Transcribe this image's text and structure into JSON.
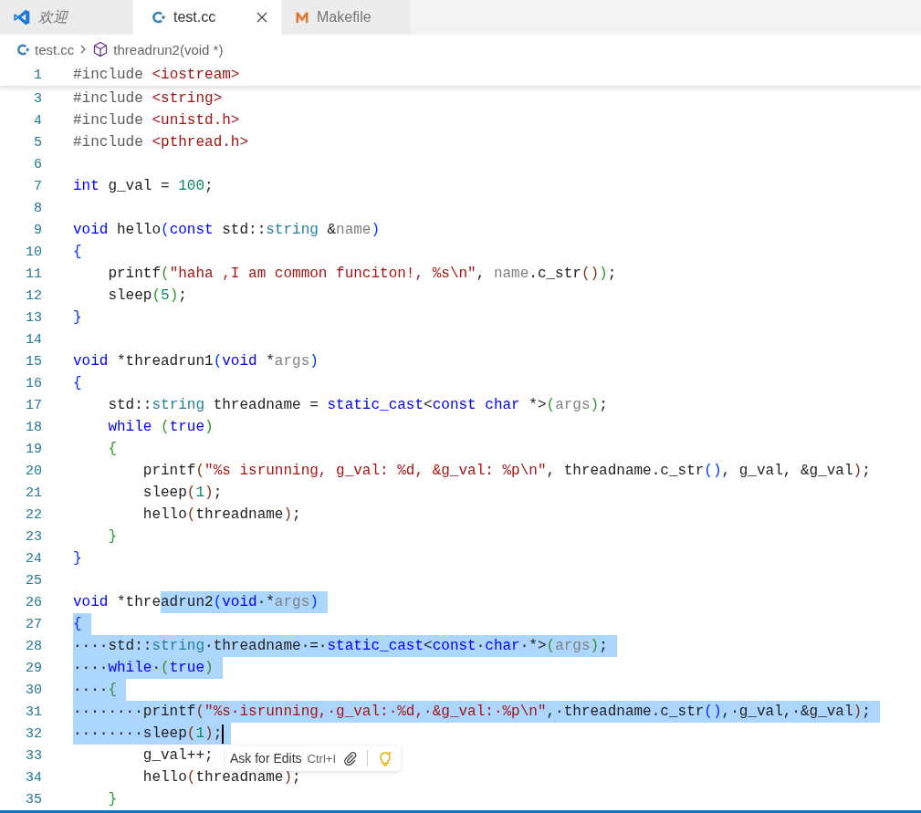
{
  "tabs": [
    {
      "label": "欢迎",
      "kind": "welcome",
      "selected": false
    },
    {
      "label": "test.cc",
      "kind": "cpp",
      "selected": true
    },
    {
      "label": "Makefile",
      "kind": "makefile",
      "selected": false
    }
  ],
  "breadcrumb": [
    {
      "label": "test.cc",
      "kind": "file"
    },
    {
      "label": "threadrun2(void *)",
      "kind": "symbol"
    }
  ],
  "sticky_line": {
    "number": "1",
    "tokens": [
      {
        "text": "#include ",
        "kind": "pp"
      },
      {
        "text": "<iostream>",
        "kind": "str"
      }
    ]
  },
  "lines": [
    {
      "number": "3",
      "tokens": [
        {
          "text": "#include ",
          "kind": "pp"
        },
        {
          "text": "<string>",
          "kind": "str"
        }
      ]
    },
    {
      "number": "4",
      "tokens": [
        {
          "text": "#include ",
          "kind": "pp"
        },
        {
          "text": "<unistd.h>",
          "kind": "str"
        }
      ]
    },
    {
      "number": "5",
      "tokens": [
        {
          "text": "#include ",
          "kind": "pp"
        },
        {
          "text": "<pthread.h>",
          "kind": "str"
        }
      ]
    },
    {
      "number": "6"
    },
    {
      "number": "7",
      "tokens": [
        {
          "text": "int",
          "kind": "kw"
        },
        {
          "text": " g_val = ",
          "kind": "plain"
        },
        {
          "text": "100",
          "kind": "num"
        },
        {
          "text": ";",
          "kind": "plain"
        }
      ]
    },
    {
      "number": "8"
    },
    {
      "number": "9",
      "tokens": [
        {
          "text": "void",
          "kind": "kw"
        },
        {
          "text": " hello",
          "kind": "fn"
        },
        {
          "text": "(",
          "kind": "br1"
        },
        {
          "text": "const",
          "kind": "kw"
        },
        {
          "text": " std::",
          "kind": "plain"
        },
        {
          "text": "string",
          "kind": "type"
        },
        {
          "text": " &",
          "kind": "plain"
        },
        {
          "text": "name",
          "kind": "param"
        },
        {
          "text": ")",
          "kind": "br1"
        }
      ]
    },
    {
      "number": "10",
      "tokens": [
        {
          "text": "{",
          "kind": "br1"
        }
      ]
    },
    {
      "number": "11",
      "tokens": [
        {
          "text": "    printf",
          "kind": "fn"
        },
        {
          "text": "(",
          "kind": "br2"
        },
        {
          "text": "\"haha ,I am common funciton!, %s\\n\"",
          "kind": "str"
        },
        {
          "text": ", ",
          "kind": "plain"
        },
        {
          "text": "name",
          "kind": "param"
        },
        {
          "text": ".c_str",
          "kind": "fn"
        },
        {
          "text": "()",
          "kind": "br3"
        },
        {
          "text": ")",
          "kind": "br2"
        },
        {
          "text": ";",
          "kind": "plain"
        }
      ]
    },
    {
      "number": "12",
      "tokens": [
        {
          "text": "    sleep",
          "kind": "fn"
        },
        {
          "text": "(",
          "kind": "br2"
        },
        {
          "text": "5",
          "kind": "num"
        },
        {
          "text": ")",
          "kind": "br2"
        },
        {
          "text": ";",
          "kind": "plain"
        }
      ]
    },
    {
      "number": "13",
      "tokens": [
        {
          "text": "}",
          "kind": "br1"
        }
      ]
    },
    {
      "number": "14"
    },
    {
      "number": "15",
      "tokens": [
        {
          "text": "void",
          "kind": "kw"
        },
        {
          "text": " *",
          "kind": "plain"
        },
        {
          "text": "threadrun1",
          "kind": "fn"
        },
        {
          "text": "(",
          "kind": "br1"
        },
        {
          "text": "void",
          "kind": "kw"
        },
        {
          "text": " *",
          "kind": "plain"
        },
        {
          "text": "args",
          "kind": "param"
        },
        {
          "text": ")",
          "kind": "br1"
        }
      ]
    },
    {
      "number": "16",
      "tokens": [
        {
          "text": "{",
          "kind": "br1"
        }
      ]
    },
    {
      "number": "17",
      "tokens": [
        {
          "text": "    std::",
          "kind": "plain"
        },
        {
          "text": "string",
          "kind": "type"
        },
        {
          "text": " threadname = ",
          "kind": "plain"
        },
        {
          "text": "static_cast",
          "kind": "kw"
        },
        {
          "text": "<",
          "kind": "plain"
        },
        {
          "text": "const char",
          "kind": "kw"
        },
        {
          "text": " *>",
          "kind": "plain"
        },
        {
          "text": "(",
          "kind": "br2"
        },
        {
          "text": "args",
          "kind": "param"
        },
        {
          "text": ")",
          "kind": "br2"
        },
        {
          "text": ";",
          "kind": "plain"
        }
      ]
    },
    {
      "number": "18",
      "tokens": [
        {
          "text": "    while ",
          "kind": "kw"
        },
        {
          "text": "(",
          "kind": "br2"
        },
        {
          "text": "true",
          "kind": "kw"
        },
        {
          "text": ")",
          "kind": "br2"
        }
      ]
    },
    {
      "number": "19",
      "tokens": [
        {
          "text": "    {",
          "kind": "br2"
        }
      ]
    },
    {
      "number": "20",
      "tokens": [
        {
          "text": "        printf",
          "kind": "fn"
        },
        {
          "text": "(",
          "kind": "br3"
        },
        {
          "text": "\"%s isrunning, g_val: %d, &g_val: %p\\n\"",
          "kind": "str"
        },
        {
          "text": ", threadname",
          "kind": "plain"
        },
        {
          "text": ".c_str",
          "kind": "fn"
        },
        {
          "text": "()",
          "kind": "br1"
        },
        {
          "text": ", g_val, &g_val",
          "kind": "plain"
        },
        {
          "text": ")",
          "kind": "br3"
        },
        {
          "text": ";",
          "kind": "plain"
        }
      ]
    },
    {
      "number": "21",
      "tokens": [
        {
          "text": "        sleep",
          "kind": "fn"
        },
        {
          "text": "(",
          "kind": "br3"
        },
        {
          "text": "1",
          "kind": "num"
        },
        {
          "text": ")",
          "kind": "br3"
        },
        {
          "text": ";",
          "kind": "plain"
        }
      ]
    },
    {
      "number": "22",
      "tokens": [
        {
          "text": "        hello",
          "kind": "fn"
        },
        {
          "text": "(",
          "kind": "br3"
        },
        {
          "text": "threadname",
          "kind": "plain"
        },
        {
          "text": ")",
          "kind": "br3"
        },
        {
          "text": ";",
          "kind": "plain"
        }
      ]
    },
    {
      "number": "23",
      "tokens": [
        {
          "text": "    }",
          "kind": "br2"
        }
      ]
    },
    {
      "number": "24",
      "tokens": [
        {
          "text": "}",
          "kind": "br1"
        }
      ]
    },
    {
      "number": "25"
    },
    {
      "number": "26",
      "tokens": [
        {
          "text": "void",
          "kind": "kw"
        },
        {
          "text": " *",
          "kind": "plain"
        },
        {
          "text": "thre",
          "kind": "fn"
        },
        {
          "text": "adrun2",
          "kind": "fn",
          "selected": true
        },
        {
          "text": "(",
          "kind": "br1",
          "selected": true
        },
        {
          "text": "void",
          "kind": "kw",
          "selected": true
        },
        {
          "text": "·*",
          "kind": "plain",
          "selected": true
        },
        {
          "text": "args",
          "kind": "param",
          "selected": true
        },
        {
          "text": ")",
          "kind": "br1",
          "selected": true
        }
      ]
    },
    {
      "number": "27",
      "selected": true,
      "tokens": [
        {
          "text": "{",
          "kind": "br1"
        }
      ]
    },
    {
      "number": "28",
      "selected": true,
      "tokens": [
        {
          "text": "····std::",
          "kind": "plain"
        },
        {
          "text": "string",
          "kind": "type"
        },
        {
          "text": "·threadname·=·",
          "kind": "plain"
        },
        {
          "text": "static_cast",
          "kind": "kw"
        },
        {
          "text": "<",
          "kind": "plain"
        },
        {
          "text": "const",
          "kind": "kw"
        },
        {
          "text": "·",
          "kind": "plain"
        },
        {
          "text": "char",
          "kind": "kw"
        },
        {
          "text": "·*>",
          "kind": "plain"
        },
        {
          "text": "(",
          "kind": "br2"
        },
        {
          "text": "args",
          "kind": "param"
        },
        {
          "text": ")",
          "kind": "br2"
        },
        {
          "text": ";",
          "kind": "plain"
        }
      ]
    },
    {
      "number": "29",
      "selected": true,
      "tokens": [
        {
          "text": "····",
          "kind": "plain"
        },
        {
          "text": "while",
          "kind": "kw"
        },
        {
          "text": "·",
          "kind": "plain"
        },
        {
          "text": "(",
          "kind": "br2"
        },
        {
          "text": "true",
          "kind": "kw"
        },
        {
          "text": ")",
          "kind": "br2"
        }
      ]
    },
    {
      "number": "30",
      "selected": true,
      "tokens": [
        {
          "text": "····",
          "kind": "plain"
        },
        {
          "text": "{",
          "kind": "br2"
        }
      ]
    },
    {
      "number": "31",
      "selected": true,
      "tokens": [
        {
          "text": "········",
          "kind": "plain"
        },
        {
          "text": "printf",
          "kind": "fn"
        },
        {
          "text": "(",
          "kind": "br3"
        },
        {
          "text": "\"%s·isrunning,·g_val:·%d,·&g_val:·%p\\n\"",
          "kind": "str"
        },
        {
          "text": ",·threadname",
          "kind": "plain"
        },
        {
          "text": ".c_str",
          "kind": "fn"
        },
        {
          "text": "()",
          "kind": "br1"
        },
        {
          "text": ",·g_val,·&g_val",
          "kind": "plain"
        },
        {
          "text": ")",
          "kind": "br3"
        },
        {
          "text": ";",
          "kind": "plain"
        }
      ]
    },
    {
      "number": "32",
      "selected": true,
      "cursor": true,
      "tokens": [
        {
          "text": "········",
          "kind": "plain"
        },
        {
          "text": "sleep",
          "kind": "fn"
        },
        {
          "text": "(",
          "kind": "br3"
        },
        {
          "text": "1",
          "kind": "num"
        },
        {
          "text": ")",
          "kind": "br3"
        },
        {
          "text": ";",
          "kind": "plain"
        }
      ]
    },
    {
      "number": "33",
      "tokens": [
        {
          "text": "        g_val++;",
          "kind": "plain"
        }
      ]
    },
    {
      "number": "34",
      "tokens": [
        {
          "text": "        hello",
          "kind": "fn"
        },
        {
          "text": "(",
          "kind": "br3"
        },
        {
          "text": "threadname",
          "kind": "plain"
        },
        {
          "text": ")",
          "kind": "br3"
        },
        {
          "text": ";",
          "kind": "plain"
        }
      ]
    },
    {
      "number": "35",
      "tokens": [
        {
          "text": "    }",
          "kind": "br2"
        }
      ]
    }
  ],
  "inline_chat_hint": {
    "label": "Ask for Edits",
    "shortcut": "Ctrl+I"
  }
}
